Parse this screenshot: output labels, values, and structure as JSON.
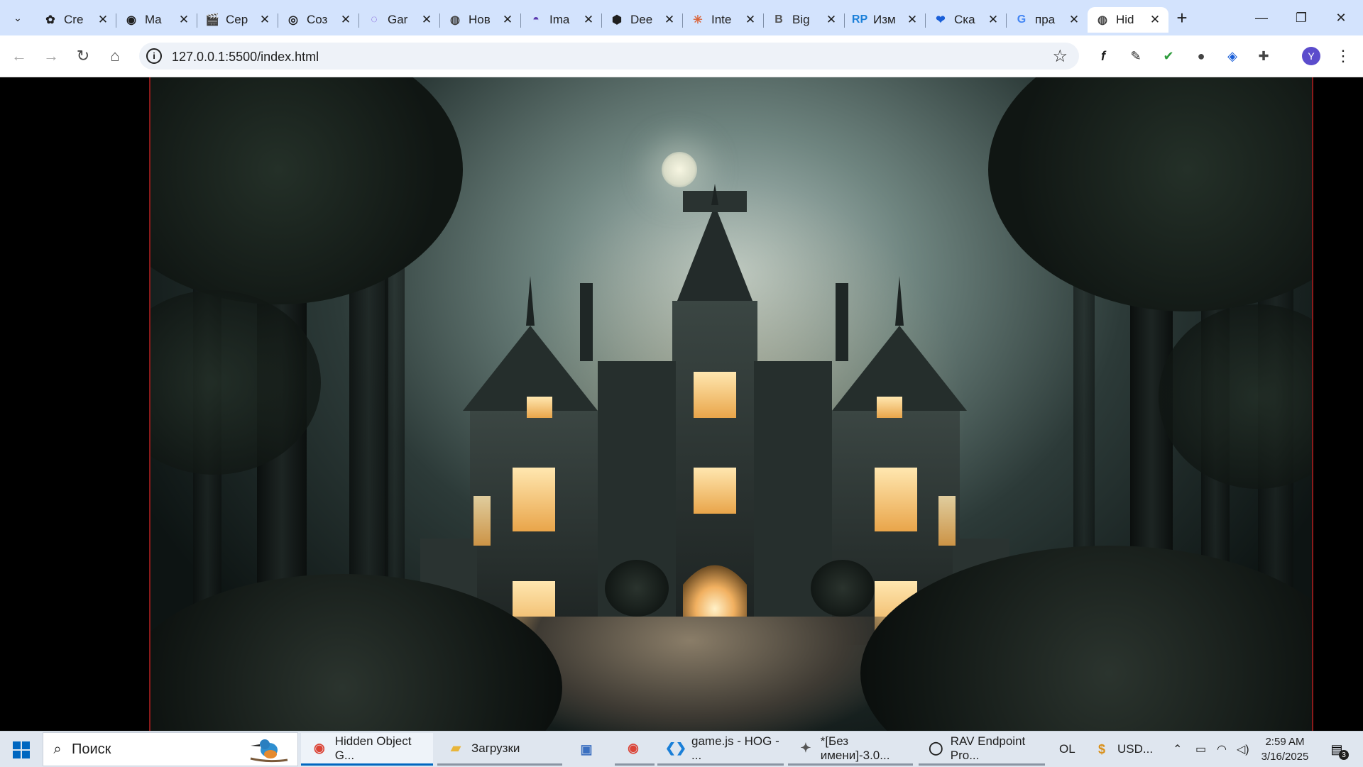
{
  "browser": {
    "tabs": [
      {
        "label": "Cre",
        "icon": "copilot-icon",
        "glyph": "✿",
        "color": "#1f1f1f"
      },
      {
        "label": "Ma",
        "icon": "github-icon",
        "glyph": "◉",
        "color": "#1f1f1f"
      },
      {
        "label": "Сер",
        "icon": "clapperboard-icon",
        "glyph": "🎬",
        "color": "#1f1f1f"
      },
      {
        "label": "Соз",
        "icon": "openai-icon",
        "glyph": "◎",
        "color": "#1f1f1f"
      },
      {
        "label": "Gar",
        "icon": "spiral-icon",
        "glyph": "◌",
        "color": "#7a4fd8"
      },
      {
        "label": "Нов",
        "icon": "globe-icon",
        "glyph": "◍",
        "color": "#444"
      },
      {
        "label": "Ima",
        "icon": "image-app-icon",
        "glyph": "◓",
        "color": "#5b3ab0"
      },
      {
        "label": "Dee",
        "icon": "deepseek-icon",
        "glyph": "⬢",
        "color": "#1f1f1f"
      },
      {
        "label": "Inte",
        "icon": "claude-icon",
        "glyph": "✳",
        "color": "#d9643a"
      },
      {
        "label": "Big",
        "icon": "b-icon",
        "glyph": "B",
        "color": "#555"
      },
      {
        "label": "Изм",
        "icon": "rp-icon",
        "glyph": "RP",
        "color": "#1a7fd8"
      },
      {
        "label": "Ска",
        "icon": "heart-icon",
        "glyph": "❤",
        "color": "#1a5fd8"
      },
      {
        "label": "пра",
        "icon": "google-icon",
        "glyph": "G",
        "color": "#4285f4"
      },
      {
        "label": "Hid",
        "icon": "globe-icon",
        "glyph": "◍",
        "color": "#444",
        "active": true
      }
    ],
    "url": "127.0.0.1:5500/index.html",
    "profile_initial": "Y"
  },
  "taskbar": {
    "search_placeholder": "Поиск",
    "apps": [
      {
        "label": "Hidden Object G...",
        "icon": "chrome-icon",
        "state": "active"
      },
      {
        "label": "Загрузки",
        "icon": "folder-icon",
        "state": "open"
      },
      {
        "label": "",
        "icon": "network-app-icon",
        "state": "none"
      },
      {
        "label": "",
        "icon": "chrome-icon",
        "state": "open"
      },
      {
        "label": "game.js - HOG - ...",
        "icon": "vscode-icon",
        "state": "open"
      },
      {
        "label": "*[Без имени]-3.0...",
        "icon": "gimp-icon",
        "state": "open"
      },
      {
        "label": "RAV Endpoint Pro...",
        "icon": "rav-icon",
        "state": "open"
      },
      {
        "label": "OL",
        "icon": "",
        "state": "none"
      },
      {
        "label": "USD...",
        "icon": "currency-icon",
        "state": "none"
      }
    ],
    "time": "2:59 AM",
    "date": "3/16/2025",
    "notification_count": "3"
  }
}
